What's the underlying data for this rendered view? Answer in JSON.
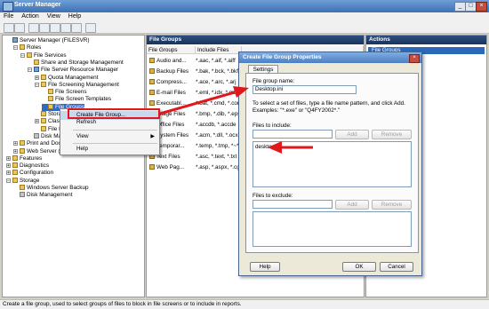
{
  "window": {
    "title": "Server Manager",
    "controls": [
      "_",
      "□",
      "×"
    ]
  },
  "menu": [
    "File",
    "Action",
    "View",
    "Help"
  ],
  "toolbar": [
    "back-icon",
    "forward-icon",
    "up-icon",
    "show-tree-icon",
    "properties-icon",
    "refresh-icon",
    "export-icon",
    "help-icon"
  ],
  "tree": [
    {
      "label": "Server Manager (FILESVR)",
      "indent": 0,
      "exp": "",
      "icon": "srv"
    },
    {
      "label": "Roles",
      "indent": 1,
      "exp": "-",
      "icon": ""
    },
    {
      "label": "File Services",
      "indent": 2,
      "exp": "-",
      "icon": ""
    },
    {
      "label": "Share and Storage Management",
      "indent": 3,
      "exp": "",
      "icon": ""
    },
    {
      "label": "File Server Resource Manager",
      "indent": 3,
      "exp": "-",
      "icon": "blue"
    },
    {
      "label": "Quota Management",
      "indent": 4,
      "exp": "+",
      "icon": ""
    },
    {
      "label": "File Screening Management",
      "indent": 4,
      "exp": "-",
      "icon": ""
    },
    {
      "label": "File Screens",
      "indent": 5,
      "exp": "",
      "icon": ""
    },
    {
      "label": "File Screen Templates",
      "indent": 5,
      "exp": "",
      "icon": ""
    },
    {
      "label": "File Groups",
      "indent": 5,
      "exp": "",
      "icon": "",
      "selected": true
    },
    {
      "label": "Storage Reports",
      "indent": 4,
      "exp": "",
      "icon": ""
    },
    {
      "label": "Classification Management",
      "indent": 4,
      "exp": "+",
      "icon": ""
    },
    {
      "label": "File Management Tasks",
      "indent": 4,
      "exp": "",
      "icon": ""
    },
    {
      "label": "Disk Management",
      "indent": 3,
      "exp": "",
      "icon": "gray"
    },
    {
      "label": "Print and Document Services",
      "indent": 1,
      "exp": "+",
      "icon": ""
    },
    {
      "label": "Web Server (IIS)",
      "indent": 1,
      "exp": "+",
      "icon": ""
    },
    {
      "label": "Features",
      "indent": 0,
      "exp": "+",
      "icon": ""
    },
    {
      "label": "Diagnostics",
      "indent": 0,
      "exp": "+",
      "icon": ""
    },
    {
      "label": "Configuration",
      "indent": 0,
      "exp": "+",
      "icon": ""
    },
    {
      "label": "Storage",
      "indent": 0,
      "exp": "-",
      "icon": ""
    },
    {
      "label": "Windows Server Backup",
      "indent": 1,
      "exp": "",
      "icon": ""
    },
    {
      "label": "Disk Management",
      "indent": 1,
      "exp": "",
      "icon": "gray"
    }
  ],
  "center": {
    "title": "File Groups",
    "columns": [
      "File Groups",
      "Include Files",
      ""
    ],
    "rows": [
      {
        "name": "Audio and...",
        "include": "*.aac, *.aif, *.aiff"
      },
      {
        "name": "Backup Files",
        "include": "*.bak, *.bck, *.bkf"
      },
      {
        "name": "Compress...",
        "include": "*.ace, *.arc, *.arj"
      },
      {
        "name": "E-mail Files",
        "include": "*.eml, *.idx, *.mbox"
      },
      {
        "name": "Executabl...",
        "include": "*.bat, *.cmd, *.com"
      },
      {
        "name": "Image Files",
        "include": "*.bmp, *.dib, *.eps"
      },
      {
        "name": "Office Files",
        "include": "*.accdb, *.accde"
      },
      {
        "name": "System Files",
        "include": "*.acm, *.dll, *.ocx"
      },
      {
        "name": "Temporar...",
        "include": "*.temp, *.tmp, *~*"
      },
      {
        "name": "Text Files",
        "include": "*.asc, *.text, *.txt"
      },
      {
        "name": "Web Pag...",
        "include": "*.asp, *.aspx, *.cgi"
      }
    ]
  },
  "actions": {
    "title": "Actions",
    "selected": "File Groups"
  },
  "context_menu": {
    "items": [
      {
        "label": "Create File Group...",
        "highlight": true
      },
      {
        "label": "Refresh"
      },
      {
        "label": "View",
        "submenu": true
      },
      {
        "label": "Help"
      }
    ]
  },
  "dialog": {
    "title": "Create File Group Properties",
    "tab": "Settings",
    "group_name_label": "File group name:",
    "group_name_value": "Desktop.ini",
    "instructions": "To select a set of files, type a file name pattern, and click Add. Examples: \"*.exe\" or \"Q4FY2002*.\"",
    "include_label": "Files to include:",
    "include_input": "",
    "include_items": [
      "desktop.ini"
    ],
    "exclude_label": "Files to exclude:",
    "exclude_input": "",
    "add_label": "Add",
    "remove_label": "Remove",
    "help_label": "Help",
    "ok_label": "OK",
    "cancel_label": "Cancel"
  },
  "status": "Create a file group, used to select groups of files to block in file screens or to include in reports.",
  "colors": {
    "arrow": "#e0181b",
    "selection": "#3169c6",
    "header": "#1f3d6b"
  }
}
